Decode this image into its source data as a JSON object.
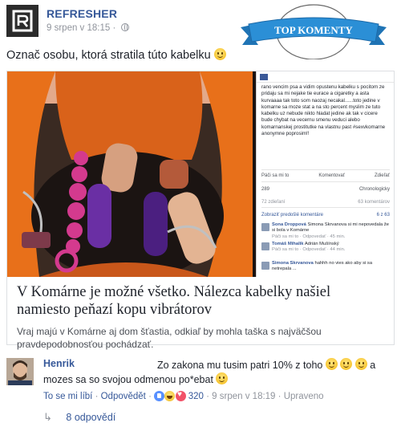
{
  "page": {
    "name": "REFRESHER",
    "meta_date": "9 srpen v 18:15",
    "meta_separator": "·"
  },
  "banner": {
    "label": "TOP KOMENTY"
  },
  "post": {
    "text": "Označ osobu, ktorá stratila túto kabelku"
  },
  "screenshot": {
    "post_text": "rano vencim psa a vidim opustenu kabelku s pocitom ze pridaju sa mi nejake tie eurace a cigaretky a asta kurvaaaa tak toto som naozaj necakal......toto jedine v komarne sa moze stat a na sto percent myslim ze tuto kabelku uz nebude nikto hladat jedine ak tak v cicere bude chybat na vecernu smenu veduci alebo komarnanskej prostitutke na vlastnu past #sexvkomarne anonymne poprosim!!",
    "actions": [
      "Páči sa mi to",
      "Komentovať",
      "Zdieľať"
    ],
    "reaction_count": "289",
    "sort_label": "Chronologicky",
    "shares": "72 zdieľaní",
    "comments_count": "63 komentárov",
    "relevant_label": "Zobraziť predošlé komentáre",
    "relevant_count": "6 z 63",
    "comments": [
      {
        "name": "Sona Droppová",
        "text": "Simona Skrvanova si mi nepovedala že si bola v Komárne",
        "meta": "Páči sa mi to · Odpovedať · 45 min."
      },
      {
        "name": "Tomáš Mihalik",
        "text": "Adrián Mušínský",
        "meta": "Páči sa mi to · Odpovedať · 44 min."
      },
      {
        "name": "Simona Skrvanova",
        "text": "hahhh no vies ako aby si sa netrepala ...",
        "meta": ""
      }
    ]
  },
  "card": {
    "title": "V Komárne je možné všetko. Nálezca kabelky našiel namiesto peňazí kopu vibrátorov",
    "description": "Vraj majú v Komárne aj dom šťastia, odkiaľ by mohla taška s najväčšou pravdepodobnosťou pochádzať."
  },
  "comment": {
    "author": "Henrik",
    "text_line1": "Zo zakona mu tusim patri 10% z toho",
    "text_line1_tail": "a",
    "text_line2": "mozes sa so svojou odmenou po*ebat",
    "like_label": "To se mi líbí",
    "reply_label": "Odpovědět",
    "reaction_count": "320",
    "date": "9 srpen v 18:19",
    "edited_label": "Upraveno",
    "separator": "·"
  },
  "replies": {
    "label": "8 odpovědí"
  },
  "colors": {
    "link_blue": "#365899",
    "banner_blue": "#2b8fd6",
    "bag_orange": "#e8701a",
    "dildo_pink": "#d43a8e"
  },
  "icons": {
    "logo": "refresher-logo-icon",
    "privacy": "globe-icon",
    "reply_arrow": "reply-arrow-icon"
  }
}
